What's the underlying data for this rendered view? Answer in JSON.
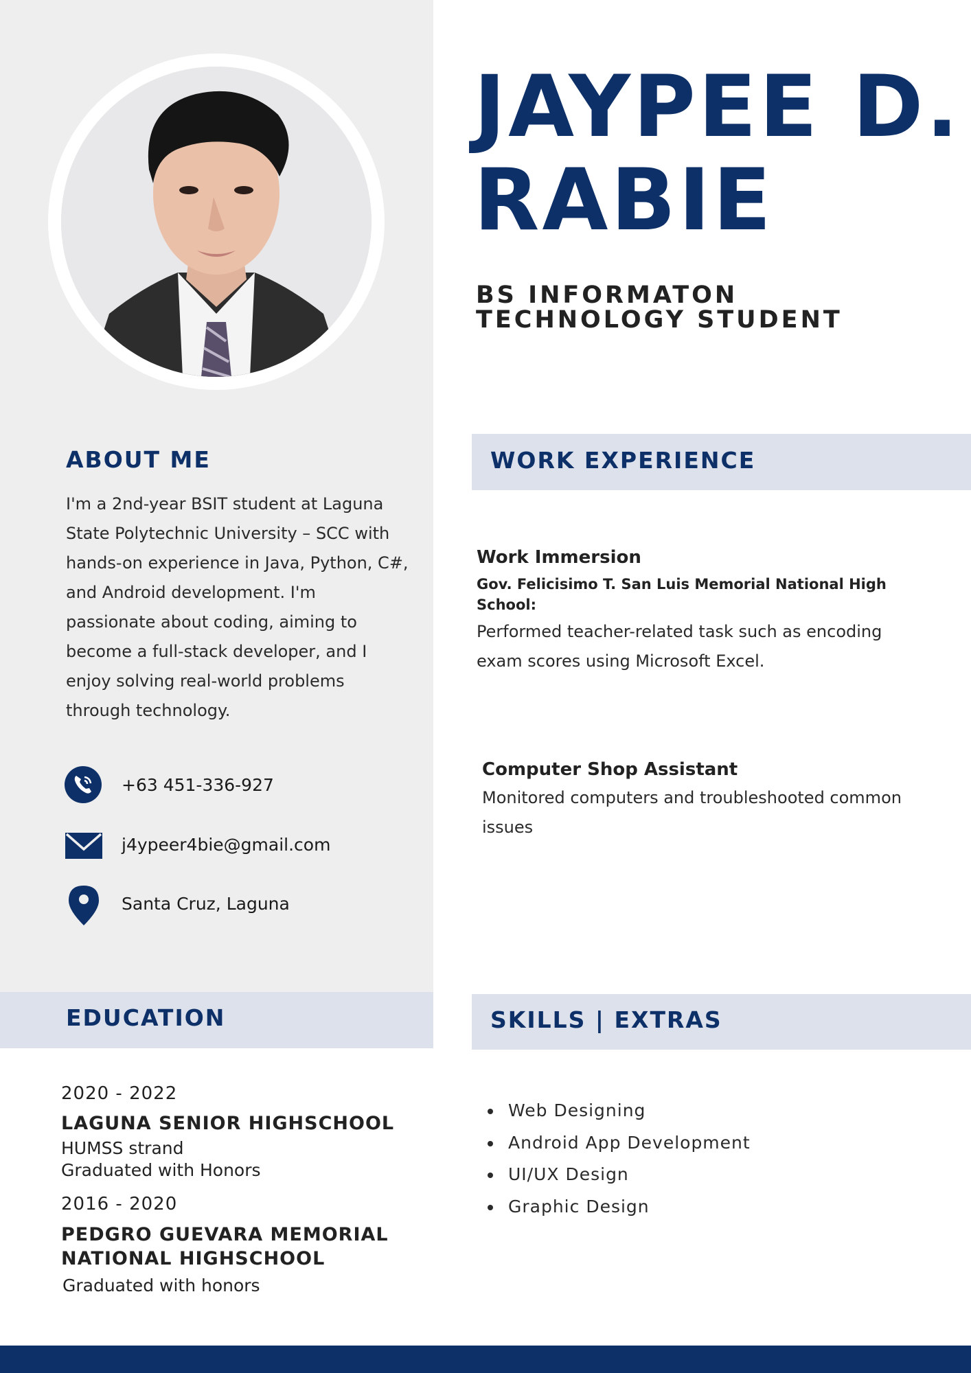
{
  "header": {
    "name_line1": "JAYPEE D.",
    "name_line2": "RABIE",
    "subtitle": "BS INFORMATON TECHNOLOGY STUDENT"
  },
  "about": {
    "heading": "ABOUT ME",
    "text": "I'm a 2nd-year BSIT student at Laguna State Polytechnic University – SCC with hands-on experience in Java, Python, C#, and Android development. I'm passionate about coding, aiming to become a full-stack developer, and I enjoy solving real-world problems through technology."
  },
  "contact": {
    "phone": "+63 451-336-927",
    "email": "j4ypeer4bie@gmail.com",
    "location": "Santa Cruz, Laguna"
  },
  "work": {
    "heading": "WORK EXPERIENCE",
    "items": [
      {
        "title": "Work Immersion",
        "organization": "Gov. Felicisimo T. San Luis Memorial National High School:",
        "description": "Performed teacher-related task such as encoding exam scores using Microsoft Excel."
      },
      {
        "title": "Computer Shop Assistant",
        "description": "Monitored computers and troubleshooted common issues"
      }
    ]
  },
  "education": {
    "heading": "EDUCATION",
    "entries": [
      {
        "years": "2020 - 2022",
        "school": "LAGUNA SENIOR HIGHSCHOOL",
        "detail1": "HUMSS strand",
        "detail2": "Graduated with Honors"
      },
      {
        "years": "2016 - 2020",
        "school_line1": "PEDGRO GUEVARA MEMORIAL",
        "school_line2": "NATIONAL HIGHSCHOOL",
        "detail1": "Graduated with honors"
      }
    ]
  },
  "skills": {
    "heading": "SKILLS | EXTRAS",
    "items": [
      "Web Designing",
      "Android App Development",
      "UI/UX Design",
      "Graphic Design"
    ]
  },
  "icons": {
    "phone": "phone-icon",
    "email": "envelope-icon",
    "location": "map-pin-icon"
  },
  "colors": {
    "accent": "#0d3068",
    "band": "#dce1eb",
    "panel": "#eeeeee"
  }
}
